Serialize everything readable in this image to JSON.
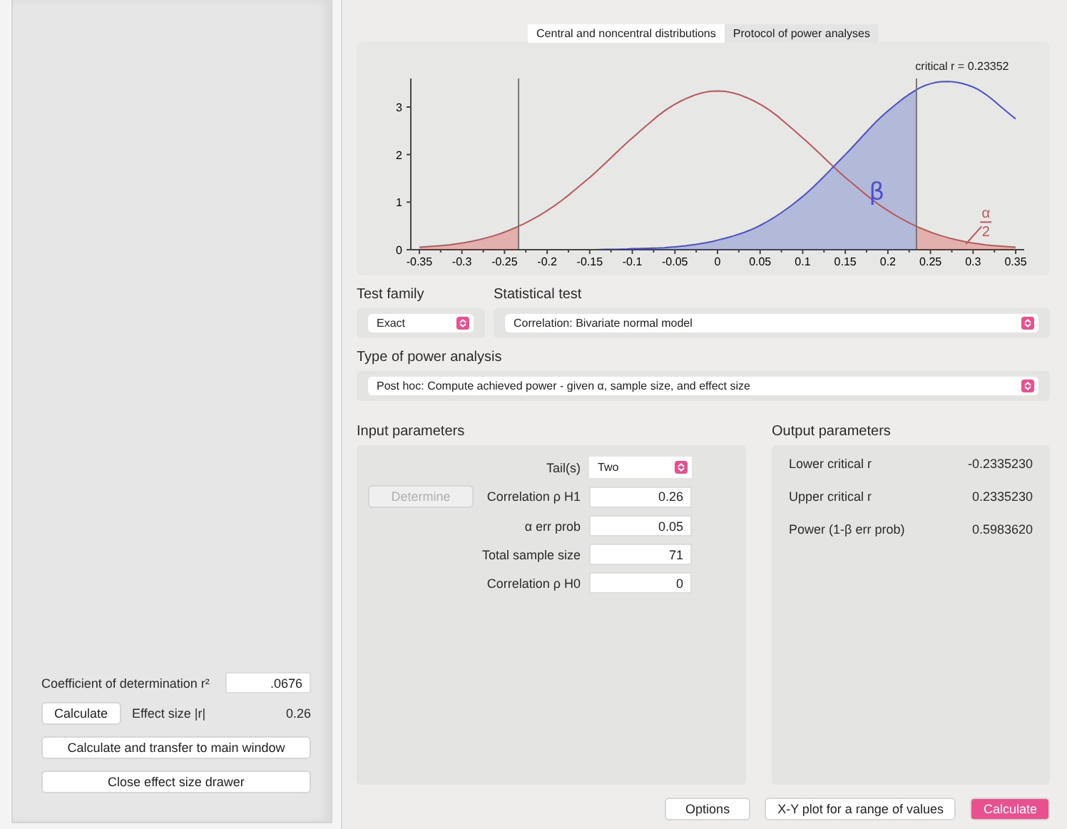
{
  "drawer": {
    "field": {
      "label": "Coefficient of determination r²",
      "value": ".0676"
    },
    "calculate_button": "Calculate",
    "effect_size": {
      "label": "Effect size |r|",
      "value": "0.26"
    },
    "buttons": [
      "Calculate and transfer to main window",
      "Close effect size drawer"
    ]
  },
  "tabs": [
    {
      "label": "Central and noncentral distributions",
      "selected": true
    },
    {
      "label": "Protocol of power analyses",
      "selected": false
    }
  ],
  "plot": {
    "chart_data": {
      "type": "line",
      "x": [
        -0.35,
        -0.3,
        -0.25,
        -0.2,
        -0.15,
        -0.1,
        -0.05,
        0,
        0.05,
        0.1,
        0.15,
        0.2,
        0.25,
        0.3,
        0.35
      ],
      "series": [
        {
          "color": "#b85a5a",
          "values": [
            0.05,
            0.14,
            0.37,
            0.82,
            1.52,
            2.35,
            3.06,
            3.34,
            3.06,
            2.35,
            1.52,
            0.82,
            0.37,
            0.14,
            0.05
          ]
        },
        {
          "color": "#4a52c8",
          "values": [
            null,
            null,
            null,
            null,
            0,
            0.02,
            0.06,
            0.2,
            0.51,
            1.12,
            2.0,
            2.92,
            3.49,
            3.42,
            2.75
          ]
        }
      ],
      "ref_lines": [
        {
          "axis": "x",
          "value": -0.23352
        },
        {
          "axis": "x",
          "value": 0.23352
        }
      ],
      "xlim": [
        -0.36,
        0.36
      ],
      "ylim": [
        0,
        3.6
      ],
      "xticks": [
        {
          "value": -0.35,
          "label": "-0.35"
        },
        {
          "value": -0.3,
          "label": "-0.3"
        },
        {
          "value": -0.25,
          "label": "-0.25"
        },
        {
          "value": -0.2,
          "label": "-0.2"
        },
        {
          "value": -0.15,
          "label": "-0.15"
        },
        {
          "value": -0.1,
          "label": "-0.1"
        },
        {
          "value": -0.05,
          "label": "-0.05"
        },
        {
          "value": 0,
          "label": "0"
        },
        {
          "value": 0.05,
          "label": "0.05"
        },
        {
          "value": 0.1,
          "label": "0.1"
        },
        {
          "value": 0.15,
          "label": "0.15"
        },
        {
          "value": 0.2,
          "label": "0.2"
        },
        {
          "value": 0.25,
          "label": "0.25"
        },
        {
          "value": 0.3,
          "label": "0.3"
        },
        {
          "value": 0.35,
          "label": "0.35"
        }
      ],
      "yticks": [
        {
          "value": 0,
          "label": "0"
        },
        {
          "value": 1,
          "label": "1"
        },
        {
          "value": 2,
          "label": "2"
        },
        {
          "value": 3,
          "label": "3"
        }
      ],
      "annotations": [
        "critical r = 0.23352",
        "β",
        "α",
        "2"
      ]
    }
  },
  "test_family": {
    "label": "Test family",
    "value": "Exact"
  },
  "statistical_test": {
    "label": "Statistical test",
    "value": "Correlation: Bivariate normal model"
  },
  "power_analysis_type": {
    "label": "Type of power analysis",
    "value": "Post hoc: Compute achieved power - given α, sample size, and effect size"
  },
  "input_parameters": {
    "title": "Input parameters",
    "determine": {
      "label": "Determine",
      "disabled": true
    },
    "rows": [
      {
        "kind": "select",
        "label": "Tail(s)",
        "value": "Two"
      },
      {
        "kind": "number",
        "label": "Correlation ρ H1",
        "value": "0.26"
      },
      {
        "kind": "number",
        "label": "α err prob",
        "value": "0.05"
      },
      {
        "kind": "number",
        "label": "Total sample size",
        "value": "71"
      },
      {
        "kind": "number",
        "label": "Correlation ρ H0",
        "value": "0"
      }
    ]
  },
  "output_parameters": {
    "title": "Output parameters",
    "rows": [
      {
        "label": "Lower critical r",
        "value": "-0.2335230"
      },
      {
        "label": "Upper critical r",
        "value": "0.2335230"
      },
      {
        "label": "Power (1-β err prob)",
        "value": "0.5983620"
      }
    ]
  },
  "buttons": [
    {
      "label": "Options",
      "primary": false
    },
    {
      "label": "X-Y plot for a range of values",
      "primary": false
    },
    {
      "label": "Calculate",
      "primary": true
    }
  ]
}
